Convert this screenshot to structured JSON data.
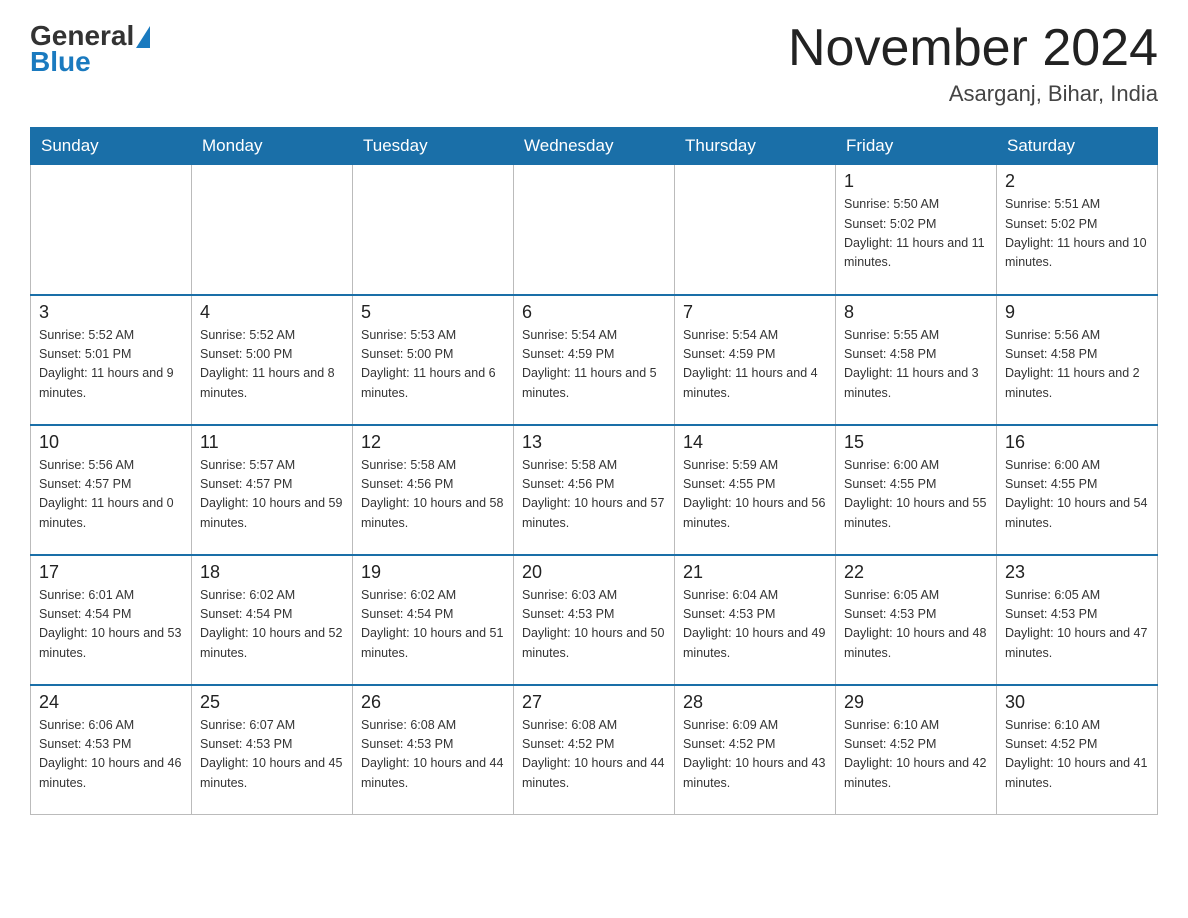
{
  "header": {
    "logo": {
      "general": "General",
      "blue": "Blue"
    },
    "title": "November 2024",
    "location": "Asarganj, Bihar, India"
  },
  "weekdays": [
    "Sunday",
    "Monday",
    "Tuesday",
    "Wednesday",
    "Thursday",
    "Friday",
    "Saturday"
  ],
  "weeks": [
    [
      {
        "day": "",
        "sunrise": "",
        "sunset": "",
        "daylight": ""
      },
      {
        "day": "",
        "sunrise": "",
        "sunset": "",
        "daylight": ""
      },
      {
        "day": "",
        "sunrise": "",
        "sunset": "",
        "daylight": ""
      },
      {
        "day": "",
        "sunrise": "",
        "sunset": "",
        "daylight": ""
      },
      {
        "day": "",
        "sunrise": "",
        "sunset": "",
        "daylight": ""
      },
      {
        "day": "1",
        "sunrise": "Sunrise: 5:50 AM",
        "sunset": "Sunset: 5:02 PM",
        "daylight": "Daylight: 11 hours and 11 minutes."
      },
      {
        "day": "2",
        "sunrise": "Sunrise: 5:51 AM",
        "sunset": "Sunset: 5:02 PM",
        "daylight": "Daylight: 11 hours and 10 minutes."
      }
    ],
    [
      {
        "day": "3",
        "sunrise": "Sunrise: 5:52 AM",
        "sunset": "Sunset: 5:01 PM",
        "daylight": "Daylight: 11 hours and 9 minutes."
      },
      {
        "day": "4",
        "sunrise": "Sunrise: 5:52 AM",
        "sunset": "Sunset: 5:00 PM",
        "daylight": "Daylight: 11 hours and 8 minutes."
      },
      {
        "day": "5",
        "sunrise": "Sunrise: 5:53 AM",
        "sunset": "Sunset: 5:00 PM",
        "daylight": "Daylight: 11 hours and 6 minutes."
      },
      {
        "day": "6",
        "sunrise": "Sunrise: 5:54 AM",
        "sunset": "Sunset: 4:59 PM",
        "daylight": "Daylight: 11 hours and 5 minutes."
      },
      {
        "day": "7",
        "sunrise": "Sunrise: 5:54 AM",
        "sunset": "Sunset: 4:59 PM",
        "daylight": "Daylight: 11 hours and 4 minutes."
      },
      {
        "day": "8",
        "sunrise": "Sunrise: 5:55 AM",
        "sunset": "Sunset: 4:58 PM",
        "daylight": "Daylight: 11 hours and 3 minutes."
      },
      {
        "day": "9",
        "sunrise": "Sunrise: 5:56 AM",
        "sunset": "Sunset: 4:58 PM",
        "daylight": "Daylight: 11 hours and 2 minutes."
      }
    ],
    [
      {
        "day": "10",
        "sunrise": "Sunrise: 5:56 AM",
        "sunset": "Sunset: 4:57 PM",
        "daylight": "Daylight: 11 hours and 0 minutes."
      },
      {
        "day": "11",
        "sunrise": "Sunrise: 5:57 AM",
        "sunset": "Sunset: 4:57 PM",
        "daylight": "Daylight: 10 hours and 59 minutes."
      },
      {
        "day": "12",
        "sunrise": "Sunrise: 5:58 AM",
        "sunset": "Sunset: 4:56 PM",
        "daylight": "Daylight: 10 hours and 58 minutes."
      },
      {
        "day": "13",
        "sunrise": "Sunrise: 5:58 AM",
        "sunset": "Sunset: 4:56 PM",
        "daylight": "Daylight: 10 hours and 57 minutes."
      },
      {
        "day": "14",
        "sunrise": "Sunrise: 5:59 AM",
        "sunset": "Sunset: 4:55 PM",
        "daylight": "Daylight: 10 hours and 56 minutes."
      },
      {
        "day": "15",
        "sunrise": "Sunrise: 6:00 AM",
        "sunset": "Sunset: 4:55 PM",
        "daylight": "Daylight: 10 hours and 55 minutes."
      },
      {
        "day": "16",
        "sunrise": "Sunrise: 6:00 AM",
        "sunset": "Sunset: 4:55 PM",
        "daylight": "Daylight: 10 hours and 54 minutes."
      }
    ],
    [
      {
        "day": "17",
        "sunrise": "Sunrise: 6:01 AM",
        "sunset": "Sunset: 4:54 PM",
        "daylight": "Daylight: 10 hours and 53 minutes."
      },
      {
        "day": "18",
        "sunrise": "Sunrise: 6:02 AM",
        "sunset": "Sunset: 4:54 PM",
        "daylight": "Daylight: 10 hours and 52 minutes."
      },
      {
        "day": "19",
        "sunrise": "Sunrise: 6:02 AM",
        "sunset": "Sunset: 4:54 PM",
        "daylight": "Daylight: 10 hours and 51 minutes."
      },
      {
        "day": "20",
        "sunrise": "Sunrise: 6:03 AM",
        "sunset": "Sunset: 4:53 PM",
        "daylight": "Daylight: 10 hours and 50 minutes."
      },
      {
        "day": "21",
        "sunrise": "Sunrise: 6:04 AM",
        "sunset": "Sunset: 4:53 PM",
        "daylight": "Daylight: 10 hours and 49 minutes."
      },
      {
        "day": "22",
        "sunrise": "Sunrise: 6:05 AM",
        "sunset": "Sunset: 4:53 PM",
        "daylight": "Daylight: 10 hours and 48 minutes."
      },
      {
        "day": "23",
        "sunrise": "Sunrise: 6:05 AM",
        "sunset": "Sunset: 4:53 PM",
        "daylight": "Daylight: 10 hours and 47 minutes."
      }
    ],
    [
      {
        "day": "24",
        "sunrise": "Sunrise: 6:06 AM",
        "sunset": "Sunset: 4:53 PM",
        "daylight": "Daylight: 10 hours and 46 minutes."
      },
      {
        "day": "25",
        "sunrise": "Sunrise: 6:07 AM",
        "sunset": "Sunset: 4:53 PM",
        "daylight": "Daylight: 10 hours and 45 minutes."
      },
      {
        "day": "26",
        "sunrise": "Sunrise: 6:08 AM",
        "sunset": "Sunset: 4:53 PM",
        "daylight": "Daylight: 10 hours and 44 minutes."
      },
      {
        "day": "27",
        "sunrise": "Sunrise: 6:08 AM",
        "sunset": "Sunset: 4:52 PM",
        "daylight": "Daylight: 10 hours and 44 minutes."
      },
      {
        "day": "28",
        "sunrise": "Sunrise: 6:09 AM",
        "sunset": "Sunset: 4:52 PM",
        "daylight": "Daylight: 10 hours and 43 minutes."
      },
      {
        "day": "29",
        "sunrise": "Sunrise: 6:10 AM",
        "sunset": "Sunset: 4:52 PM",
        "daylight": "Daylight: 10 hours and 42 minutes."
      },
      {
        "day": "30",
        "sunrise": "Sunrise: 6:10 AM",
        "sunset": "Sunset: 4:52 PM",
        "daylight": "Daylight: 10 hours and 41 minutes."
      }
    ]
  ]
}
